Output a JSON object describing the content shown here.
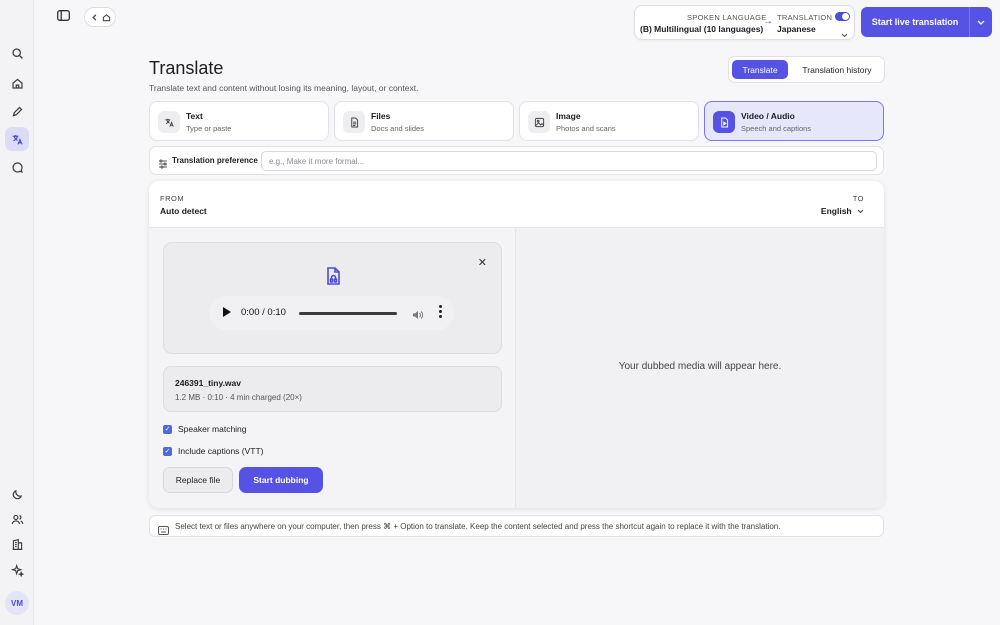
{
  "rail": {
    "items": [
      "search-icon",
      "home-icon",
      "pen-icon",
      "translate-icon",
      "chat-icon"
    ],
    "bottom_items": [
      "moon-icon",
      "users-icon",
      "building-icon",
      "sparkle-icon"
    ],
    "avatar": "VM"
  },
  "topbar": {
    "spoken_language_caption": "SPOKEN LANGUAGE",
    "spoken_language_value": "(B) Multilingual (10 languages)",
    "translation_caption": "TRANSLATION",
    "translation_value": "Japanese",
    "translation_enabled": true,
    "live_button": "Start live translation"
  },
  "header": {
    "title": "Translate",
    "subtitle": "Translate text and content without losing its meaning, layout, or context.",
    "tabs": [
      "Translate",
      "Translation history"
    ],
    "active_tab": "Translate"
  },
  "cards": [
    {
      "title": "Text",
      "subtitle": "Type or paste",
      "icon": "translate-icon"
    },
    {
      "title": "Files",
      "subtitle": "Docs and slides",
      "icon": "document-icon"
    },
    {
      "title": "Image",
      "subtitle": "Photos and scans",
      "icon": "image-icon"
    },
    {
      "title": "Video / Audio",
      "subtitle": "Speech and captions",
      "icon": "media-file-icon"
    }
  ],
  "selected_card": "Video / Audio",
  "preference": {
    "label": "Translation preference",
    "placeholder": "e.g., Make it more formal..."
  },
  "panel": {
    "from_caption": "FROM",
    "from_value": "Auto detect",
    "to_caption": "TO",
    "to_value": "English",
    "player_time": "0:00 / 0:10",
    "player_progress": 0,
    "file_name": "246391_tiny.wav",
    "file_meta": "1.2 MB · 0:10 · 4 min charged (20×)",
    "options": [
      {
        "label": "Speaker matching",
        "checked": true
      },
      {
        "label": "Include captions (VTT)",
        "checked": true
      }
    ],
    "replace_button": "Replace file",
    "start_button": "Start dubbing",
    "output_placeholder": "Your dubbed media will appear here."
  },
  "hint": "Select text or files anywhere on your computer, then press ⌘ + Option to translate. Keep the content selected and press the shortcut again to replace it with the translation.",
  "colors": {
    "accent": "#5552e4",
    "selected_card_bg": "#e7e7fb"
  }
}
